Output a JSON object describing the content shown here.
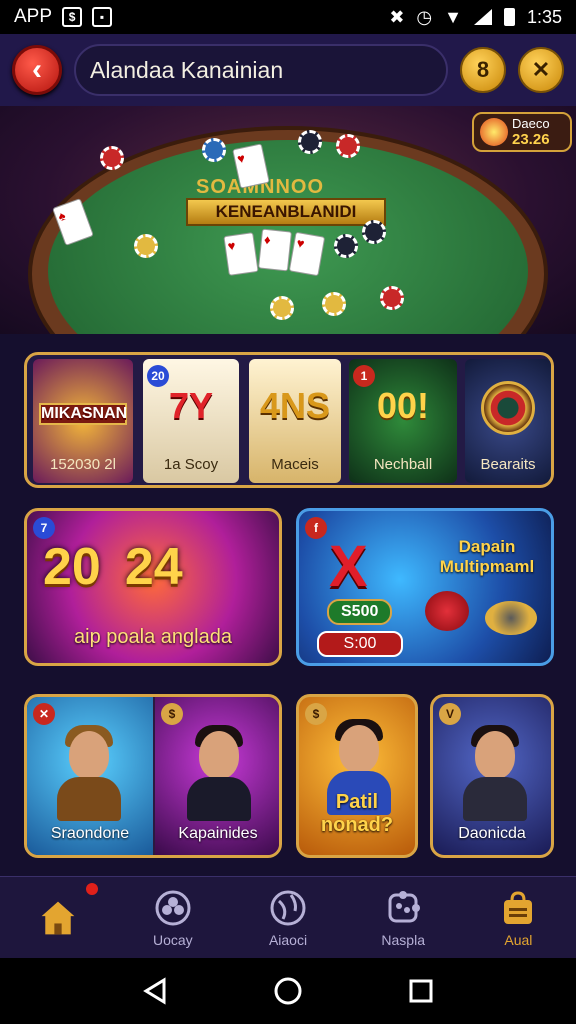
{
  "status_bar": {
    "app_label": "APP",
    "time": "1:35"
  },
  "header": {
    "title": "Alandaa Kanainian"
  },
  "hero": {
    "felt_title": "SOAMNNOO",
    "felt_banner": "KENEANBLANIDI",
    "score_label": "Daeco",
    "score_value": "23.26"
  },
  "slots": [
    {
      "big": "MIKASNAN",
      "label": "152030 2l"
    },
    {
      "big": "7Y",
      "label": "1a Scoy"
    },
    {
      "big": "4NS",
      "label": "Maceis"
    },
    {
      "big": "00!",
      "label": "Nechball"
    },
    {
      "big": "",
      "label": "Bearaits"
    }
  ],
  "promo_left": {
    "numbers": [
      "20",
      "24"
    ],
    "caption": "aip poala anglada"
  },
  "promo_right": {
    "title": "Dapain Multipmaml",
    "mark": "X",
    "chip1": "S500",
    "chip2": "S:00"
  },
  "characters": [
    {
      "name": "Sraondone"
    },
    {
      "name": "Kapainides"
    },
    {
      "name": "Patil nonad?"
    },
    {
      "name": "Daonicda"
    }
  ],
  "bottom_nav": [
    {
      "label": "",
      "icon": "home-icon"
    },
    {
      "label": "Uocay",
      "icon": "clover-icon"
    },
    {
      "label": "Aiaoci",
      "icon": "globe-icon"
    },
    {
      "label": "Naspla",
      "icon": "puzzle-icon"
    },
    {
      "label": "Aual",
      "icon": "bag-icon"
    }
  ],
  "colors": {
    "accent_gold": "#d9a545",
    "back_red": "#d6291e",
    "bg": "#150f2e"
  }
}
